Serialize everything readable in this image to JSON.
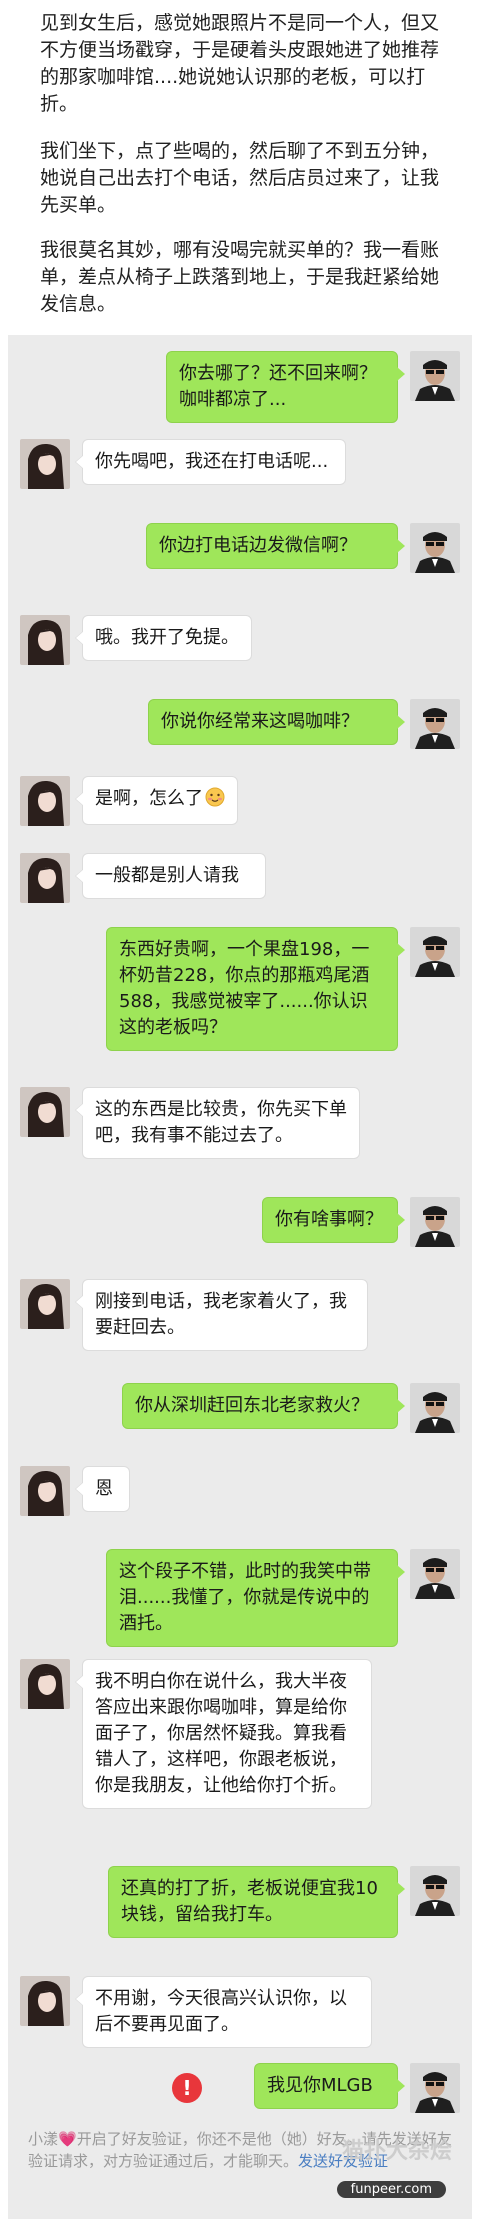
{
  "story": {
    "para1": "见到女生后，感觉她跟照片不是同一个人，但又不方便当场戳穿，于是硬着头皮跟她进了她推荐的那家咖啡馆....她说她认识那的老板，可以打折。",
    "para2": "我们坐下，点了些喝的，然后聊了不到五分钟，她说自己出去打个电话，然后店员过来了，让我先买单。",
    "para3": "我很莫名其妙，哪有没喝完就买单的？我一看账单，差点从椅子上跌落到地上，于是我赶紧给她发信息。"
  },
  "messages": [
    {
      "side": "right",
      "text": "你去哪了？还不回来啊？咖啡都凉了..."
    },
    {
      "side": "left",
      "text": "你先喝吧，我还在打电话呢..."
    },
    {
      "side": "right",
      "text": "你边打电话边发微信啊？"
    },
    {
      "side": "left",
      "text": "哦。我开了免提。"
    },
    {
      "side": "right",
      "text": "你说你经常来这喝咖啡？"
    },
    {
      "side": "left",
      "text": "是啊，怎么了",
      "emoji": "blush-emoji"
    },
    {
      "side": "left",
      "text": "一般都是别人请我"
    },
    {
      "side": "right",
      "text": "东西好贵啊，一个果盘198，一杯奶昔228，你点的那瓶鸡尾酒588，我感觉被宰了......你认识这的老板吗？"
    },
    {
      "side": "left",
      "text": "这的东西是比较贵，你先买下单吧，我有事不能过去了。"
    },
    {
      "side": "right",
      "text": "你有啥事啊？"
    },
    {
      "side": "left",
      "text": "刚接到电话，我老家着火了，我要赶回去。"
    },
    {
      "side": "right",
      "text": "你从深圳赶回东北老家救火？"
    },
    {
      "side": "left",
      "text": "恩"
    },
    {
      "side": "right",
      "text": "这个段子不错，此时的我笑中带泪......我懂了，你就是传说中的酒托。"
    },
    {
      "side": "left",
      "text": "我不明白你在说什么，我大半夜答应出来跟你喝咖啡，算是给你面子了，你居然怀疑我。算我看错人了，这样吧，你跟老板说，你是我朋友，让他给你打个折。"
    },
    {
      "side": "right",
      "text": "还真的打了折，老板说便宜我10块钱，留给我打车。"
    },
    {
      "side": "left",
      "text": "不用谢，今天很高兴认识你，以后不要再见面了。"
    },
    {
      "side": "right",
      "text": "我见你MLGB",
      "failed": true,
      "failed_icon": "!"
    }
  ],
  "notice": {
    "name": "小漾",
    "text1": "开启了好友验证，你还不是他（她）好友。请先发送好友验证请求，对方验证通过后，才能聊天。",
    "link": "发送好友验证"
  },
  "watermark": {
    "text": "猫扑大杂烩",
    "url": "funpeer.com"
  },
  "colors": {
    "chat_bg": "#ebebeb",
    "bubble_sent": "#9fe65a",
    "bubble_received": "#ffffff",
    "error": "#e8363b",
    "link": "#4a7ec2"
  }
}
